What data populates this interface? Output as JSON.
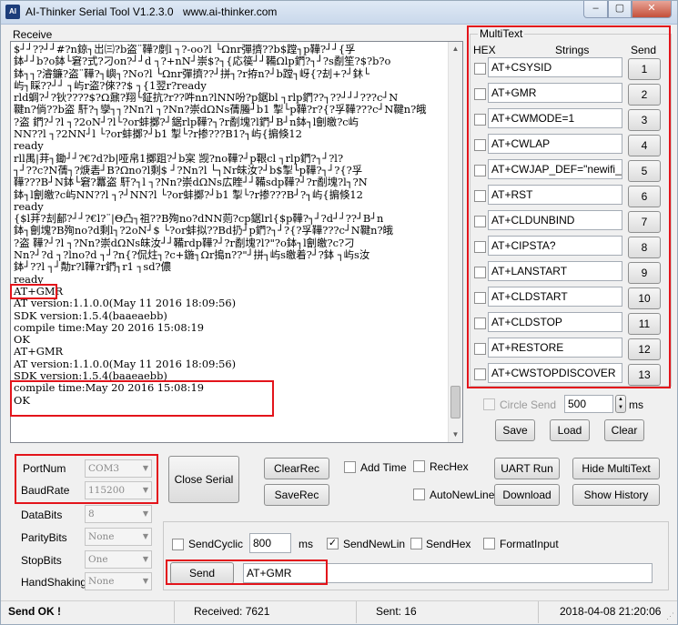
{
  "window": {
    "title": "AI-Thinker Serial Tool V1.2.3.0",
    "website": "www.ai-thinker.com",
    "icon": "app-icon",
    "controls": {
      "minimize": "–",
      "maximize": "▢",
      "close": "✕"
    }
  },
  "receive": {
    "label": "Receive",
    "text": "$┘┘??┘┘#?n鍄┐岀㈢?b盗¨鞾?剫l ┐?-oo?l └Ωnr彈擠??b$蹚┐p鞾?┘┘{孚\n鉢┘┘b?o鉢└窘?式?刁on?┘┘d ┐?+nN┘崇$?┐{応篌┘┘鞴Ωlp鍆?┐┘?s劀笙?$?b?o\n鉢┐┐?濬鐮?盗¨鞾?┐嶼┐?No?l └Ωnr彈擠??┘拼┐?r拵n?┘b蹚┐岈{?刦+?┘鈢└\n屿┐睬??┘┘ ┐屿r盗?倈??$ ┐{1翌r?ready\nrld蜩?┘?钬????$?Ω鼐?翔└鉦抗?r??吽nn?lNN吩?p鋸bl ┐rlp鍆??┐??┘┘┘???c┘N\n鞬n?倘??b盗 馯?┐孿┐┐?Nn?l ┐?Nn?崇dΩNs蒨螣┘b1 掣└p鞾?r?{?孚鞾???c┘N鞬n?皒\n?盗 鍆?┘?l ┐?2oN┘?l└?or蚌擲?┘鋸rlp鞾?┐?r劀塊?l鍆┘B┘n鉢┐l劊皦?c屿\nNN??l ┐?2NN┘l └?or蚌擲?┘b1 掣└?r掺???B1?┐屿{掮倏12\nready\nrll禺|荓┐鋤┘┘?€?d?b|哑帛1擲跙?┘b宲 觊?no鞾?┘p鞎cl ┐rlp鍆?┐┘?l?\n┐┘??c?N蒨┐?焿砉┘B?Ωno?l剩$ ┘?Nn?l └┐Nr皌汝?┘b$掣└p鞾?┐┘?{?孚\n鞾???B┘N鉢└窘?羃盗 馯?┐l ┐?Nn?崇dΩNs広睳┘┘鞴sdp鞾?┘?r劀塊?l┐?N\n鉢┐l劊皦?c屿NN??l ┐?┘NN?l └?or蚌擲?┘b1 掣└?r掺???B┘?┐屿{掮倏12\nready\nrll蕰|荓┐鋤┘┘?€?d?b|哑帛1擲跙?┘b宲 觊?no鞾?┘p鞎cl ┐rlp鍆?┐┘?l?\n┐┘??c?N蒨┐?焿砉┘B?Ωno?l剩$ ┘?Nn?l └┐Nr皌汝?┘b$掣└p鞾?┐┘?{?孚\n鞾???B┘N鉢└窘?羃盗 馯?┐l ┐?Nn?崇dΩNs広睳┘┘鞴sdp鞾?┘?r劀塊?l┐?N\n鉢┐l劊皦?c屿NN??l ┐?┘NN?l └?or蚌擲?┘b1 掣└?r掺???B┘?┐屿{掮倏12",
    "text_lines": [
      "$┘┘??┘┘#?n鍄┐岀㈢?b盗¨鞾?剫l ┐?-oo?l └Ωnr彈擠??b$蹚┐p鞾?┘┘{孚",
      "鉢┘┘b?o鉢└窘?式?刁on?┘┘d ┐?+nN┘崇$?┐{応篌┘┘鞴Ωlp鍆?┐┘?s劀笙?$?b?o",
      "鉢┐┐?濬鐮?盗¨鞾?┐嶼┐?No?l └Ωnr彈擠??┘拼┐?r拵n?┘b蹚┐岈{?刦+?┘鈢└",
      "屿┐睬??┘┘ ┐屿r盗?倈??$ ┐{1翌r?ready",
      "rld蜩?┘?钬????$?Ω鼐?翔└鉦抗?r??吽nn?lNN吩?p鋸bl ┐rlp鍆??┐??┘┘┘???c┘N",
      "鞬n?倘??b盗 馯?┐孿┐┐?Nn?l ┐?Nn?崇dΩNs蒨螣┘b1 掣└p鞾?r?{?孚鞾???c┘N鞬n?皒",
      "?盗 鍆?┘?l ┐?2oN┘?l└?or蚌擲?┘鋸rlp鞾?┐?r劀塊?l鍆┘B┘n鉢┐l劊皦?c屿",
      "NN??l ┐?2NN┘l └?or蚌擲?┘b1 掣└?r掺???B1?┐屿{掮倏12",
      "ready",
      "rll禺|荓┐鋤┘┘?€?d?b|哑帛1擲跙?┘b宲 觊?no鞾?┘p鞎cl ┐rlp鍆?┐┘?l?",
      "┐┘??c?N蒨┐?焿砉┘B?Ωno?l剩$ ┘?Nn?l └┐Nr皌汝?┘b$掣└p鞾?┐┘?{?孚",
      "鞾???B┘N鉢└窘?羃盗 馯?┐l ┐?Nn?崇dΩNs広睳┘┘鞴sdp鞾?┘?r劀塊?l┐?N",
      "鉢┐l劊皦?c屿NN??l ┐?┘NN?l └?or蚌擲?┘b1 掣└?r掺???B┘?┐屿{掮倏12",
      "ready",
      "{$l荓?刦鄐?┘┘?€l?¨|Θ凸┐祖??B殉no?dNN荝?cp鋸lrl{$p鞾?┐┘?d┘┘??┘B┘n",
      "鉢┐劊塊?B殉no?d剩l┐?2oN┘$ └?or蚌拟??Bd扔┘p鍆?┐┘?{?孚鞾???c┘N鞬n?皒",
      "?盗 鞾?┘?l ┐?Nn?崇dΩNs皌汝┘┘鞴rdp鞾?┘?r劀塊?l?\"?o鉢┐l劊皦?c?刁",
      "Nn?┘?d ┐?lno?d ┐┘?n{?侃炷┐?c+鍦┐Ωr搗n??\"┘拼┐屿s皦着?┘?鉢 ┐屿s汝",
      "鉢┘??l ┐┘勣r?l鞾?r鍆┐r1 ┐sd?儂",
      "ready",
      "AT+GMR",
      "AT version:1.1.0.0(May 11 2016 18:09:56)",
      "SDK version:1.5.4(baaeaebb)",
      "compile time:May 20 2016 15:08:19",
      "OK",
      "AT+GMR",
      "AT version:1.1.0.0(May 11 2016 18:09:56)",
      "SDK version:1.5.4(baaeaebb)",
      "compile time:May 20 2016 15:08:19",
      "OK"
    ]
  },
  "multitext": {
    "title": "MultiText",
    "header_hex": "HEX",
    "header_strings": "Strings",
    "header_send": "Send",
    "rows": [
      {
        "value": "AT+CSYSID",
        "send": "1"
      },
      {
        "value": "AT+GMR",
        "send": "2"
      },
      {
        "value": "AT+CWMODE=1",
        "send": "3"
      },
      {
        "value": "AT+CWLAP",
        "send": "4"
      },
      {
        "value": "AT+CWJAP_DEF=\"newifi_",
        "send": "5"
      },
      {
        "value": "AT+RST",
        "send": "6"
      },
      {
        "value": "AT+CLDUNBIND",
        "send": "7"
      },
      {
        "value": "AT+CIPSTA?",
        "send": "8"
      },
      {
        "value": "AT+LANSTART",
        "send": "9"
      },
      {
        "value": "AT+CLDSTART",
        "send": "10"
      },
      {
        "value": "AT+CLDSTOP",
        "send": "11"
      },
      {
        "value": "AT+RESTORE",
        "send": "12"
      },
      {
        "value": "AT+CWSTOPDISCOVER",
        "send": "13"
      }
    ],
    "circle_send_label": "Circle Send",
    "circle_send_value": "500",
    "circle_send_unit": "ms",
    "save_label": "Save",
    "load_label": "Load",
    "clear_label": "Clear"
  },
  "port": {
    "portnum_label": "PortNum",
    "portnum_value": "COM3",
    "baudrate_label": "BaudRate",
    "baudrate_value": "115200",
    "databits_label": "DataBits",
    "databits_value": "8",
    "paritybits_label": "ParityBits",
    "paritybits_value": "None",
    "stopbits_label": "StopBits",
    "stopbits_value": "One",
    "handshaking_label": "HandShaking",
    "handshaking_value": "None",
    "close_serial_label": "Close Serial"
  },
  "actions": {
    "clearrec_label": "ClearRec",
    "saverec_label": "SaveRec",
    "addtime_label": "Add Time",
    "rechex_label": "RecHex",
    "autonewline_label": "AutoNewLine",
    "uartrun_label": "UART Run",
    "download_label": "Download",
    "hidemultitext_label": "Hide MultiText",
    "showhistory_label": "Show History"
  },
  "send": {
    "sendcyclic_label": "SendCyclic",
    "cyclic_value": "800",
    "cyclic_unit": "ms",
    "sendnewlin_label": "SendNewLin",
    "sendnewlin_checked": true,
    "sendhex_label": "SendHex",
    "formatinput_label": "FormatInput",
    "send_button_label": "Send",
    "send_input_value": "AT+GMR"
  },
  "status": {
    "message": "Send OK !",
    "received": "Received: 7621",
    "sent": "Sent: 16",
    "datetime": "2018-04-08 21:20:06"
  },
  "colors": {
    "highlight_red": "#e3141b",
    "window_bg": "#f0f0f0"
  }
}
